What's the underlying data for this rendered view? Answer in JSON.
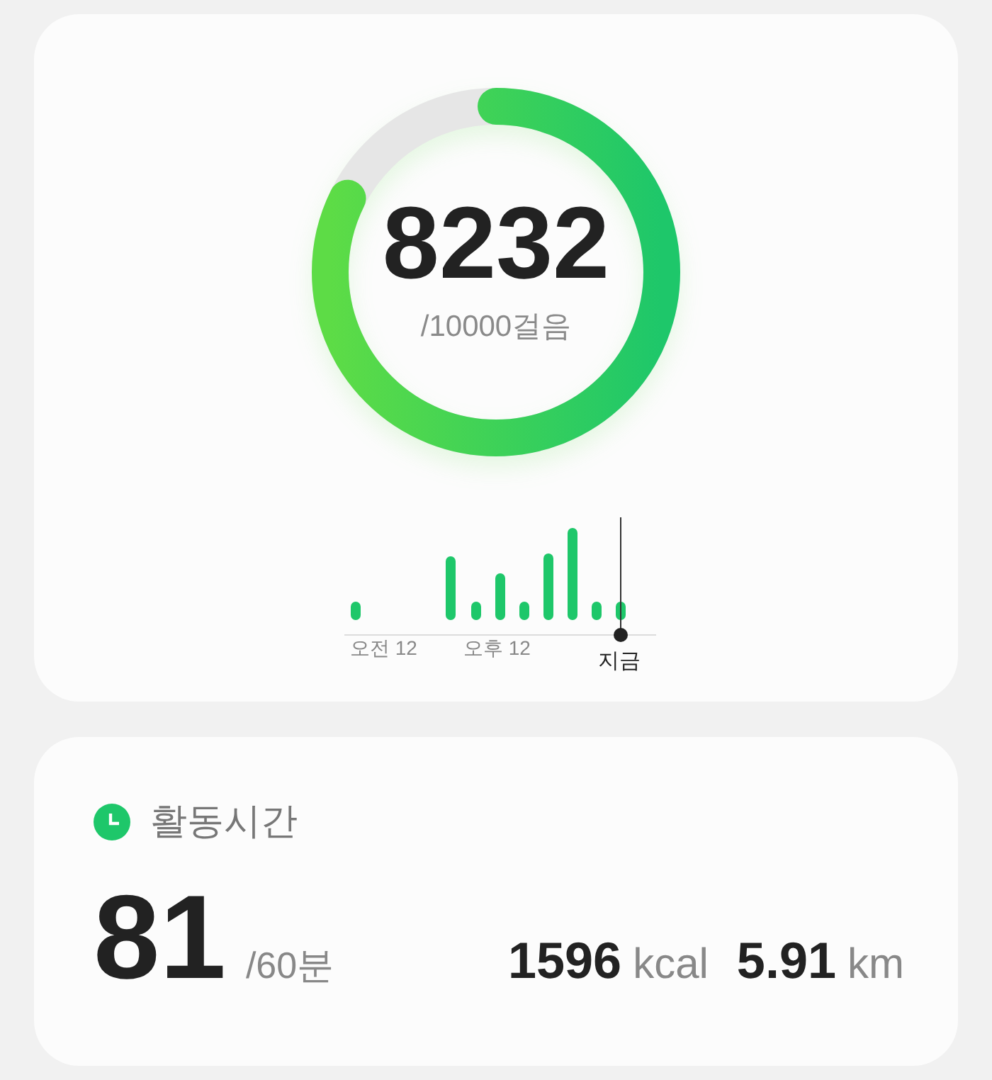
{
  "steps": {
    "count": "8232",
    "goal": "/10000걸음",
    "level": 0.8232
  },
  "timeline": {
    "labels": [
      {
        "text": "오전 12",
        "kind": "axis"
      },
      {
        "text": "오후 12",
        "kind": "axis"
      },
      {
        "text": "지금",
        "kind": "now"
      }
    ]
  },
  "active_time": {
    "title": "활동시간",
    "value": "81",
    "goal": "/60분",
    "stats": [
      {
        "value": "1596",
        "unit": "kcal"
      },
      {
        "value": "5.91",
        "unit": "km"
      }
    ]
  }
}
